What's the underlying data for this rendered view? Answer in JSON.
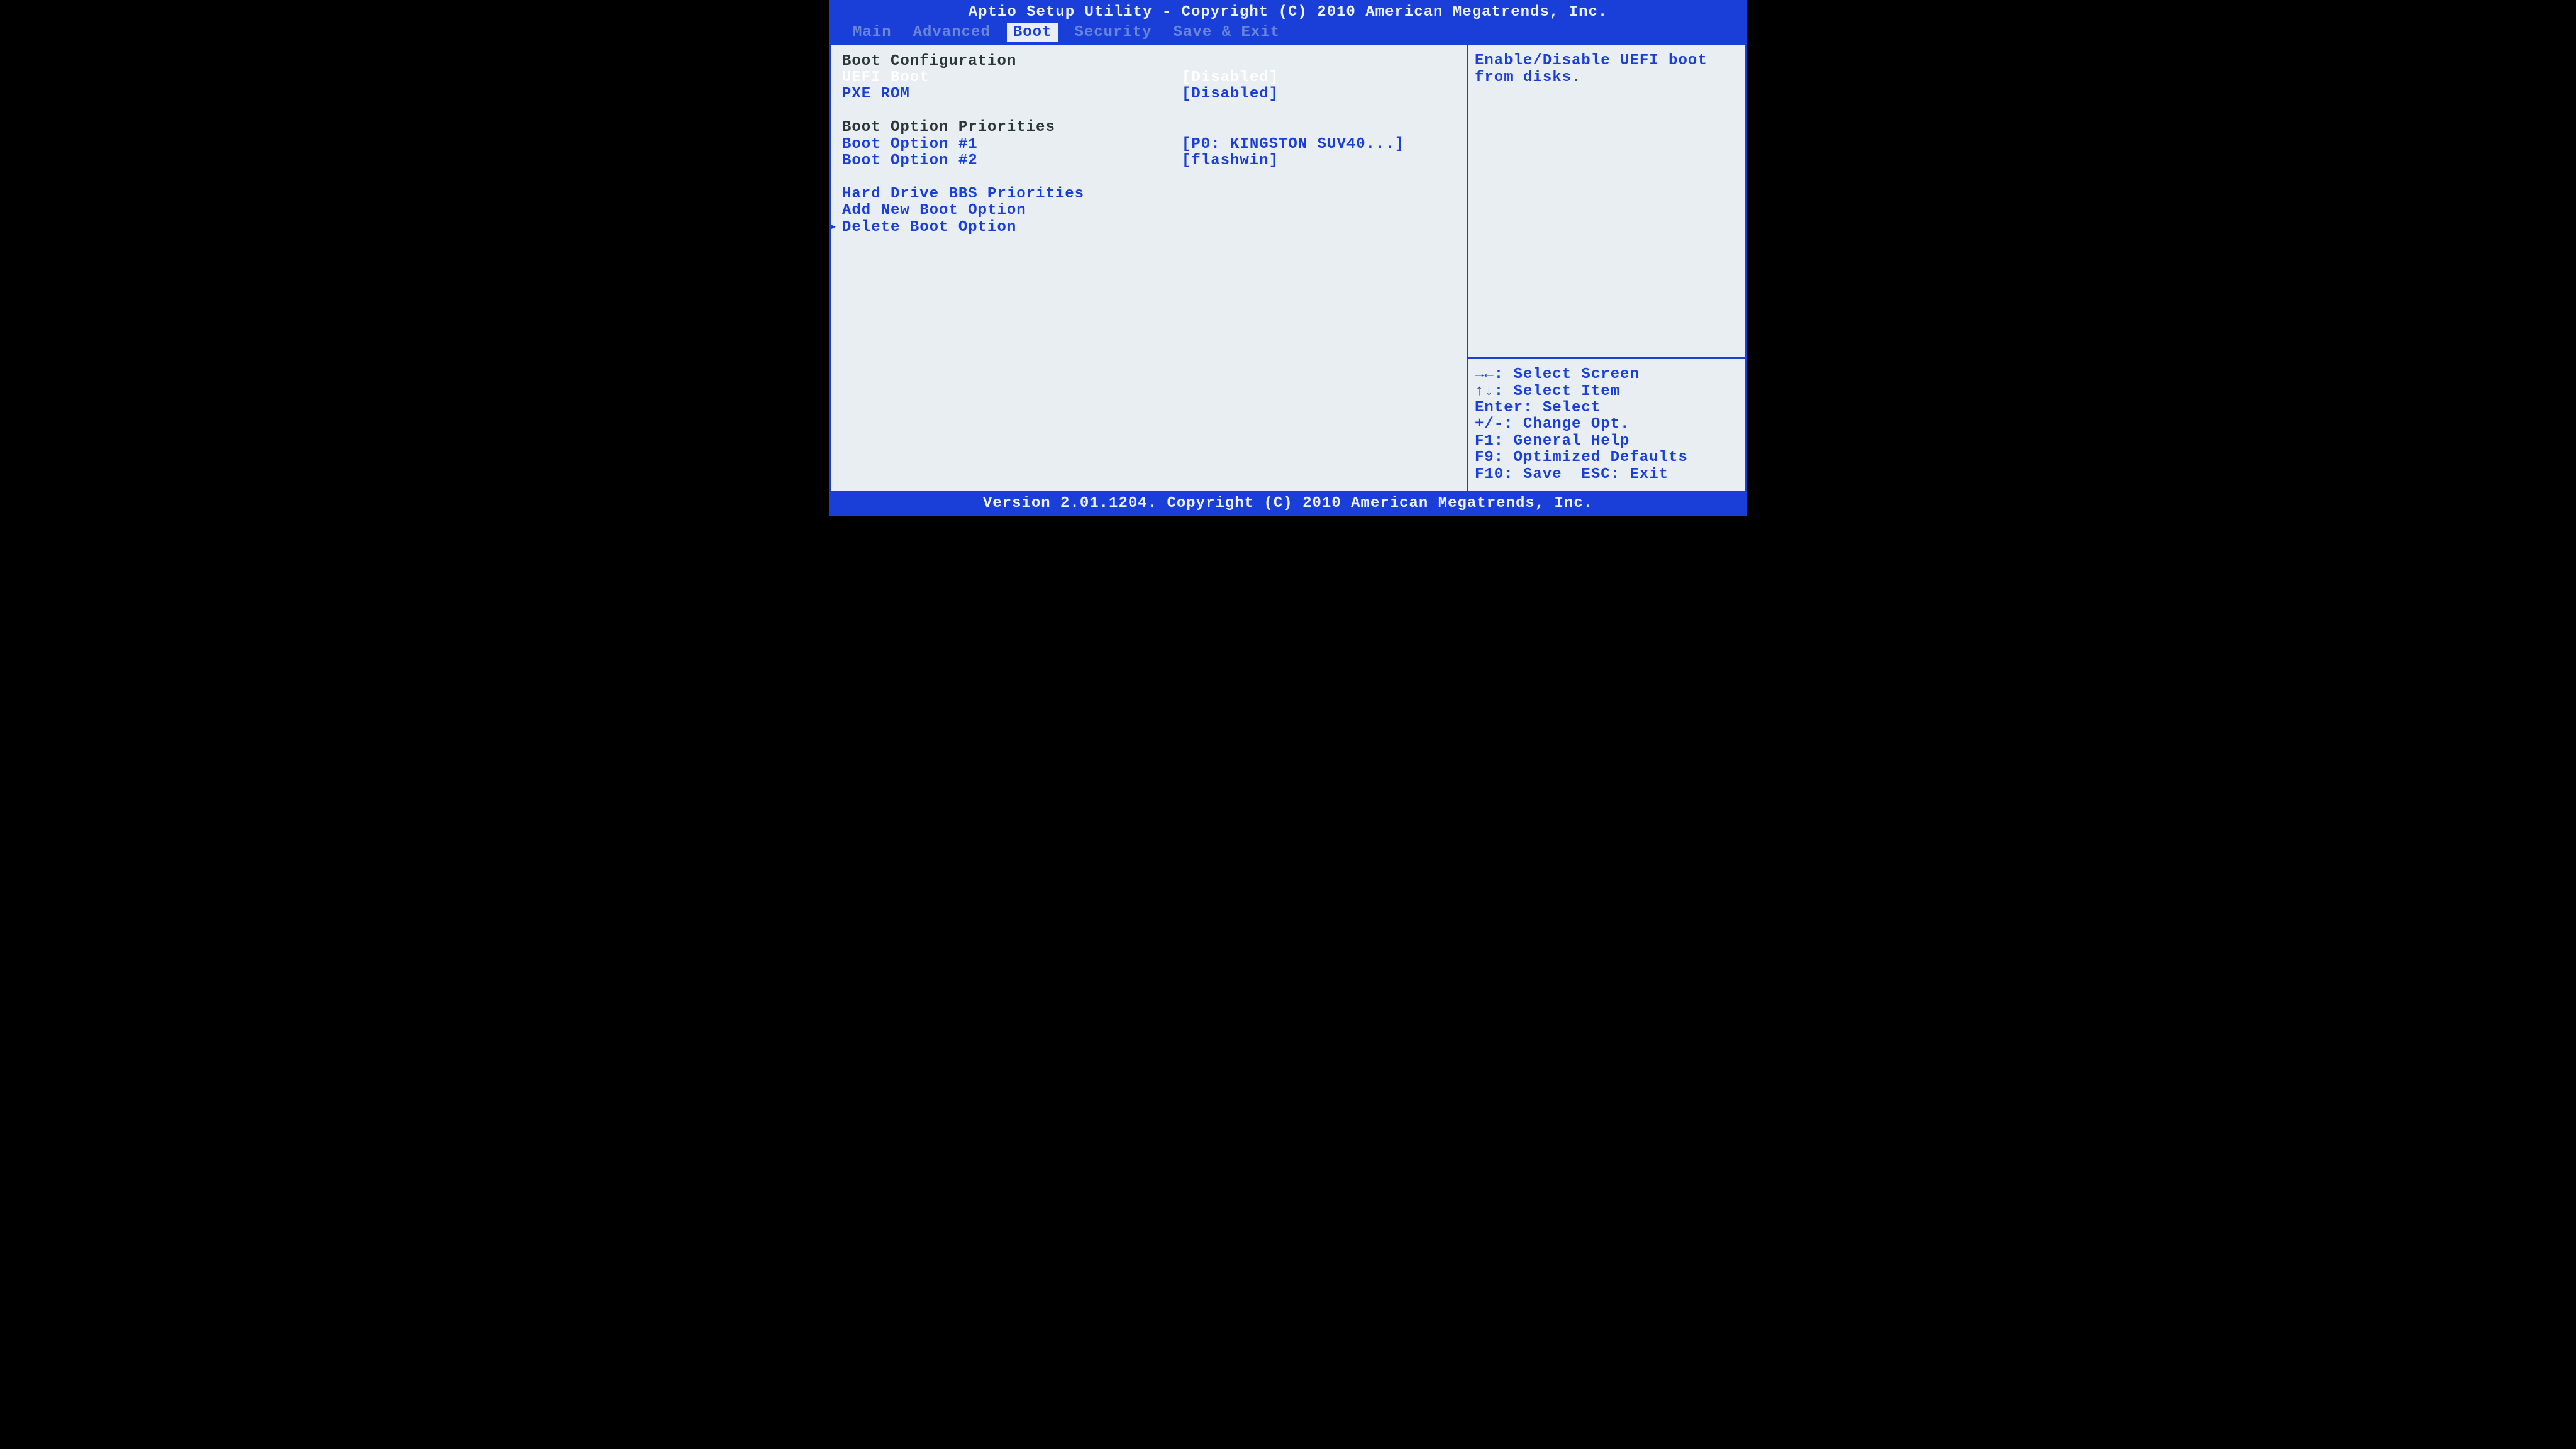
{
  "title_bar": "Aptio Setup Utility - Copyright (C) 2010 American Megatrends, Inc.",
  "footer_bar": "Version 2.01.1204. Copyright (C) 2010 American Megatrends, Inc.",
  "menu_tabs": {
    "main": "Main",
    "advanced": "Advanced",
    "boot": "Boot",
    "security": "Security",
    "save_exit": "Save & Exit"
  },
  "active_tab": "boot",
  "sections": {
    "boot_config_header": "Boot Configuration",
    "uefi_boot": {
      "label": "UEFI Boot",
      "value": "[Disabled]"
    },
    "pxe_rom": {
      "label": "PXE ROM",
      "value": "[Disabled]"
    },
    "priorities_header": "Boot Option Priorities",
    "boot_opt_1": {
      "label": "Boot Option #1",
      "value": "[P0: KINGSTON SUV40...]"
    },
    "boot_opt_2": {
      "label": "Boot Option #2",
      "value": "[flashwin]"
    },
    "hd_bbs": "Hard Drive BBS Priorities",
    "add_boot": "Add New Boot Option",
    "del_boot": "Delete Boot Option"
  },
  "help_text": "Enable/Disable UEFI boot from disks.",
  "nav_help": {
    "l0": "→←: Select Screen",
    "l1": "↑↓: Select Item",
    "l2": "Enter: Select",
    "l3": "+/-: Change Opt.",
    "l4": "F1: General Help",
    "l5": "F9: Optimized Defaults",
    "l6": "F10: Save  ESC: Exit"
  },
  "submenu_arrow": "▸"
}
